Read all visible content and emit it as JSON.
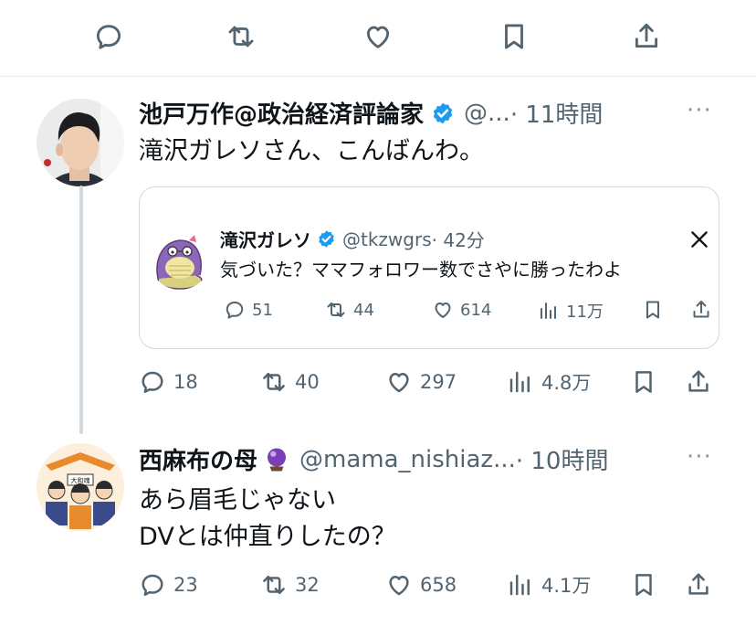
{
  "top_actions": [
    {
      "name": "reply-icon"
    },
    {
      "name": "retweet-icon"
    },
    {
      "name": "like-icon"
    },
    {
      "name": "bookmark-icon"
    },
    {
      "name": "share-icon"
    }
  ],
  "reply1": {
    "display_name": "池戸万作@政治経済評論家",
    "handle": "@...",
    "time": "· 11時間",
    "more": "···",
    "text": "滝沢ガレソさん、こんばんわ。",
    "quote": {
      "display_name": "滝沢ガレソ",
      "handle": "@tkzwgrs",
      "time": "· 42分",
      "text": "気づいた？ママフォロワー数でさやに勝ったわよ",
      "replies": "51",
      "retweets": "44",
      "likes": "614",
      "views": "11万"
    },
    "replies": "18",
    "retweets": "40",
    "likes": "297",
    "views": "4.8万"
  },
  "reply2": {
    "display_name": "西麻布の母",
    "handle": "@mama_nishiaz...",
    "time": "· 10時間",
    "more": "···",
    "text_line1": "あら眉毛じゃない",
    "text_line2": "DVとは仲直りしたの？",
    "replies": "23",
    "retweets": "32",
    "likes": "658",
    "views": "4.1万"
  },
  "colors": {
    "verified": "#1d9bf0",
    "muted": "#536471",
    "text": "#0f1419",
    "border": "#cfd9de"
  }
}
